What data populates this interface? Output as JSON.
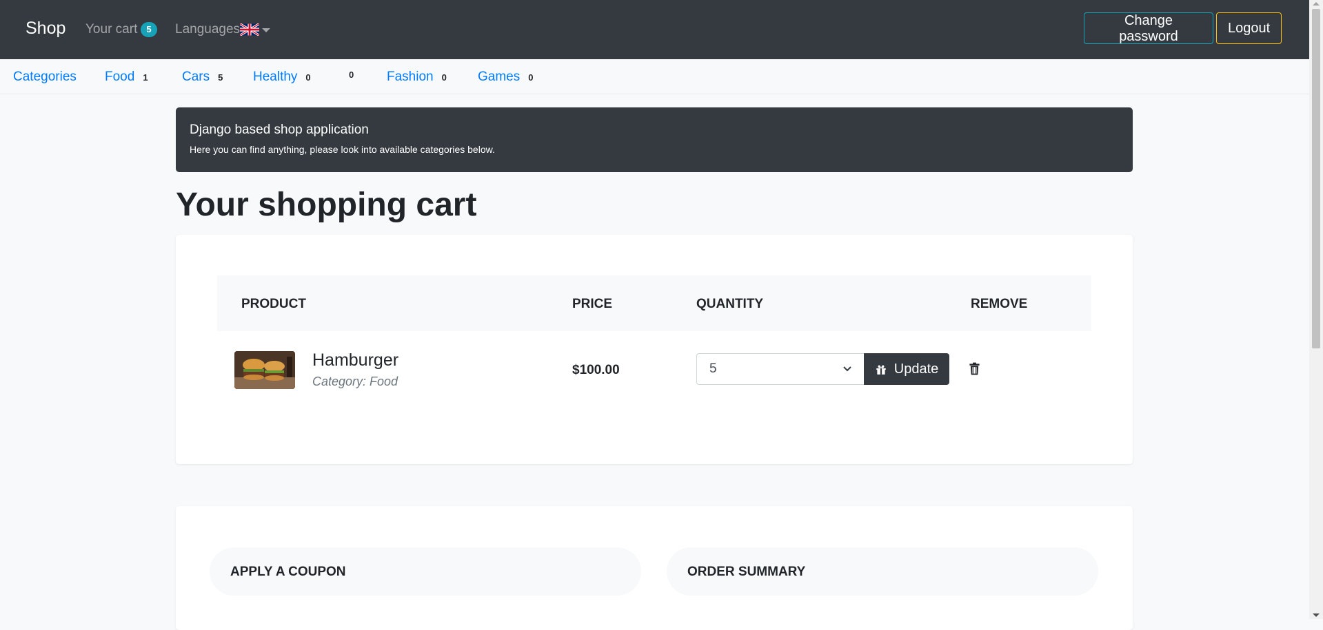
{
  "navbar": {
    "brand": "Shop",
    "cart_label": "Your cart",
    "cart_count": "5",
    "languages_label": "Languages",
    "change_password": "Change password",
    "logout": "Logout"
  },
  "categories": {
    "title": "Categories",
    "items": [
      {
        "label": "Food",
        "count": "1"
      },
      {
        "label": "Cars",
        "count": "5"
      },
      {
        "label": "Healthy",
        "count": "0"
      },
      {
        "label": "",
        "count": "0"
      },
      {
        "label": "Fashion",
        "count": "0"
      },
      {
        "label": "Games",
        "count": "0"
      }
    ]
  },
  "jumbotron": {
    "title": "Django based shop application",
    "subtitle": "Here you can find anything, please look into available categories below."
  },
  "page": {
    "title": "Your shopping cart"
  },
  "cart_table": {
    "headers": {
      "product": "Product",
      "price": "Price",
      "quantity": "Quantity",
      "remove": "Remove"
    },
    "rows": [
      {
        "name": "Hamburger",
        "category": "Category: Food",
        "price": "$100.00",
        "quantity": "5",
        "update_label": "Update"
      }
    ]
  },
  "coupon": {
    "title": "Apply a coupon"
  },
  "summary": {
    "title": "Order summary"
  },
  "colors": {
    "navbar_bg": "#343a40",
    "link": "#007bff",
    "info": "#17a2b8",
    "warning": "#ffc107"
  }
}
